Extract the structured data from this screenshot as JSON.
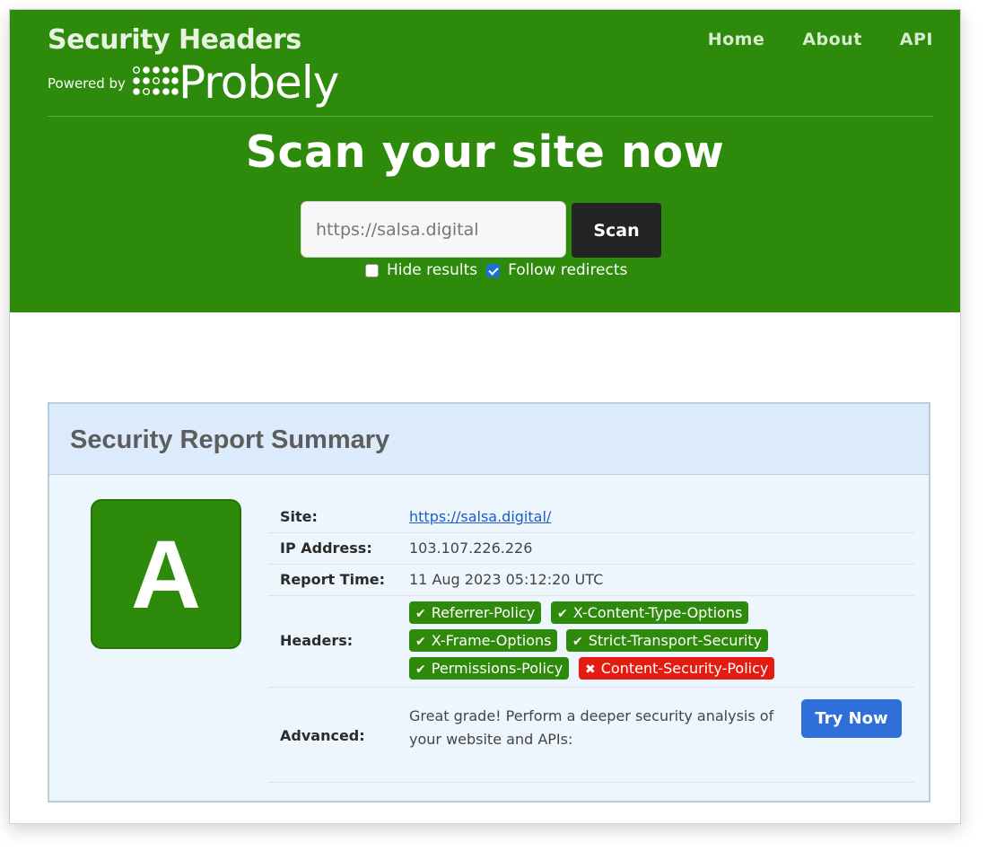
{
  "header": {
    "title": "Security Headers",
    "powered_by": "Powered by",
    "logo_text": "Probely",
    "nav": [
      "Home",
      "About",
      "API"
    ]
  },
  "hero": {
    "heading": "Scan your site now",
    "input_value": "https://salsa.digital",
    "scan_label": "Scan",
    "hide_results_label": "Hide results",
    "hide_results_checked": false,
    "follow_redirects_label": "Follow redirects",
    "follow_redirects_checked": true
  },
  "report": {
    "title": "Security Report Summary",
    "grade": "A",
    "site_label": "Site:",
    "site_value": "https://salsa.digital/",
    "ip_label": "IP Address:",
    "ip_value": "103.107.226.226",
    "time_label": "Report Time:",
    "time_value": "11 Aug 2023 05:12:20 UTC",
    "headers_label": "Headers:",
    "headers": [
      {
        "name": "Referrer-Policy",
        "status": "pass"
      },
      {
        "name": "X-Content-Type-Options",
        "status": "pass"
      },
      {
        "name": "X-Frame-Options",
        "status": "pass"
      },
      {
        "name": "Strict-Transport-Security",
        "status": "pass"
      },
      {
        "name": "Permissions-Policy",
        "status": "pass"
      },
      {
        "name": "Content-Security-Policy",
        "status": "fail"
      }
    ],
    "advanced_label": "Advanced:",
    "advanced_text": "Great grade! Perform a deeper security analysis of your website and APIs:",
    "try_now_label": "Try Now"
  },
  "colors": {
    "brand_green": "#2d8a0b",
    "fail_red": "#e41b10",
    "button_blue": "#2e6fd9"
  }
}
